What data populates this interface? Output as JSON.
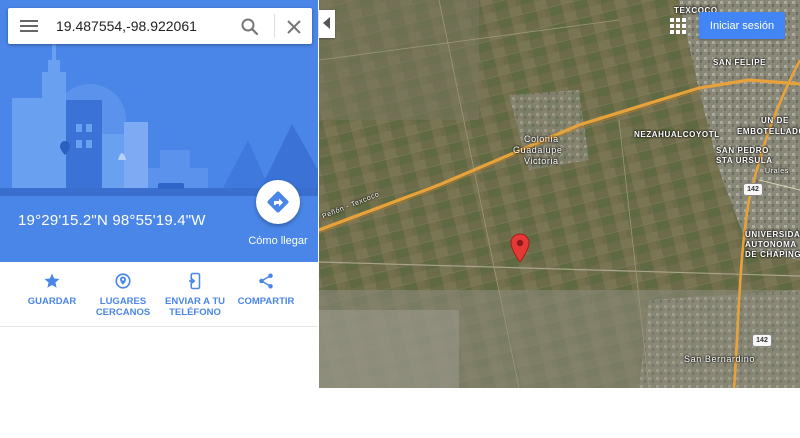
{
  "search": {
    "query": "19.487554,-98.922061"
  },
  "place": {
    "coordinates": "19°29'15.2\"N 98°55'19.4\"W",
    "directions_label": "Cómo llegar"
  },
  "actions": [
    {
      "label": "GUARDAR",
      "icon": "star-icon"
    },
    {
      "label": "LUGARES CERCANOS",
      "icon": "nearby-icon"
    },
    {
      "label": "ENVIAR A TU TELÉFONO",
      "icon": "send-to-phone-icon"
    },
    {
      "label": "COMPARTIR",
      "icon": "share-icon"
    }
  ],
  "map": {
    "signin_label": "Iniciar sesión",
    "labels": {
      "texcoco": "TEXCOCO",
      "san_felipe": "SAN FELIPE",
      "colonia": "Colonia",
      "guadalupe": "Guadalupe",
      "victoria": "Victoria",
      "nezahualcoyotl": "NEZAHUALCOYOTL",
      "un_de": "UN DE",
      "embotellador": "EMBOTELLADOR",
      "san_pedro": "SAN PEDRO",
      "sta_ursula": "STA URSULA",
      "urales": "Urales",
      "universidad": "UNIVERSIDAD",
      "autonoma": "AUTONOMA",
      "de_chapingo": "DE CHAPINGO",
      "san_bernardino": "San Bernardino",
      "highway_road": "Peñón - Texcoco"
    },
    "route_shield": "142",
    "colors": {
      "terrain": "#6f6e4c",
      "highway": "#e8a23a",
      "accent": "#4285f4",
      "pin": "#e53935"
    }
  },
  "theme": {
    "panel_blue": "#4a86e8"
  }
}
